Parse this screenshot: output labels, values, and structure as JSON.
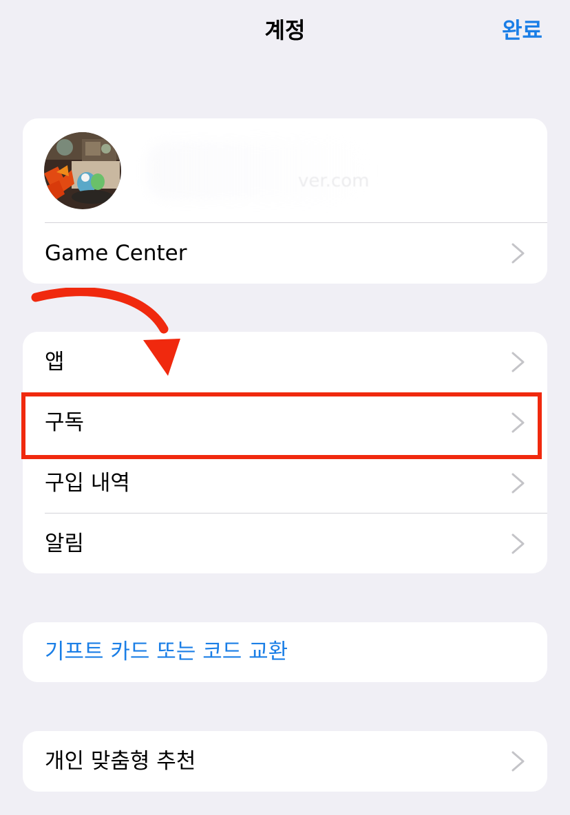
{
  "header": {
    "title": "계정",
    "done_label": "완료"
  },
  "profile": {
    "game_center_label": "Game Center"
  },
  "menu": {
    "items": [
      {
        "label": "앱"
      },
      {
        "label": "구독"
      },
      {
        "label": "구입 내역"
      },
      {
        "label": "알림"
      }
    ]
  },
  "gift": {
    "label": "기프트 카드 또는 코드 교환"
  },
  "recommend": {
    "label": "개인 맞춤형 추천"
  },
  "colors": {
    "accent": "#1a7ee6",
    "highlight": "#f0290e",
    "background": "#f0eff5"
  }
}
